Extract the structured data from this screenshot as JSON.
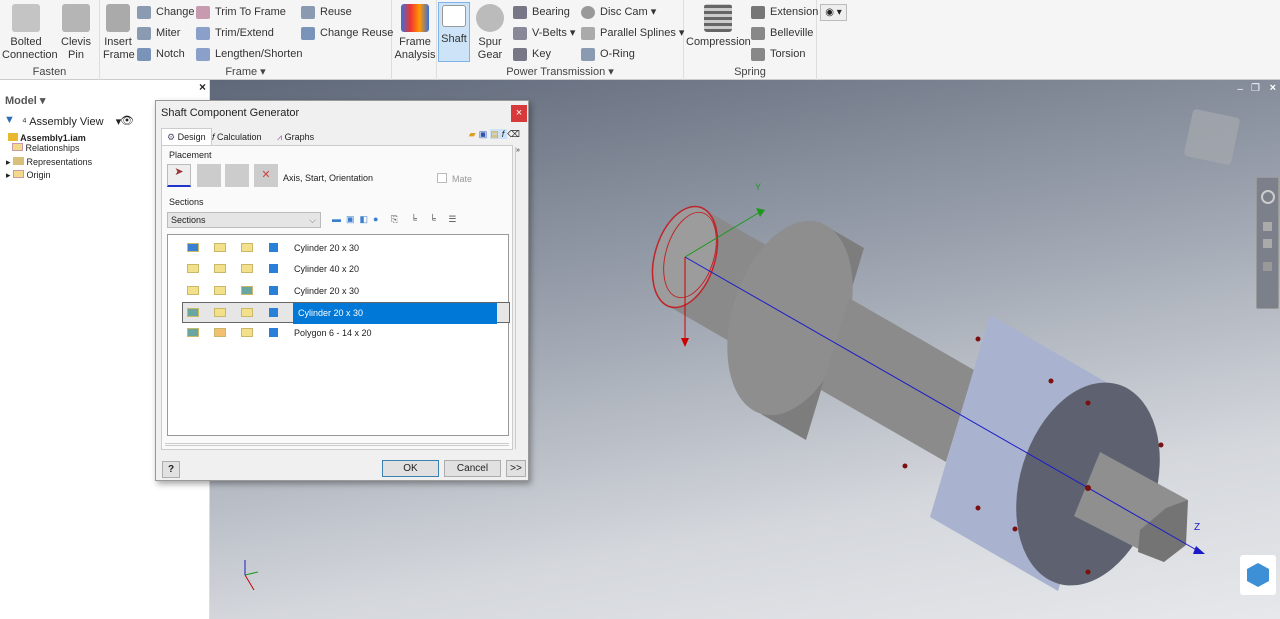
{
  "ribbon": {
    "fasten": {
      "label": "Fasten",
      "bolted": "Bolted\nConnection",
      "bolted1": "Bolted",
      "bolted2": "Connection",
      "clevis1": "Clevis",
      "clevis2": "Pin"
    },
    "frame": {
      "label": "Frame ▾",
      "insert1": "Insert",
      "insert2": "Frame",
      "change": "Change",
      "miter": "Miter",
      "notch": "Notch",
      "trim_to_frame": "Trim To Frame",
      "trim_extend": "Trim/Extend",
      "lengthen": "Lengthen/Shorten",
      "reuse": "Reuse",
      "change_reuse": "Change Reuse"
    },
    "analysis": {
      "l1": "Frame",
      "l2": "Analysis"
    },
    "power": {
      "label": "Power Transmission ▾",
      "shaft": "Shaft",
      "spur1": "Spur",
      "spur2": "Gear",
      "bearing": "Bearing",
      "vbelts": "V-Belts ▾",
      "key": "Key",
      "disc_cam": "Disc Cam ▾",
      "splines": "Parallel Splines ▾",
      "oring": "O-Ring"
    },
    "spring": {
      "label": "Spring",
      "compression": "Compression",
      "extension": "Extension",
      "belleville": "Belleville",
      "torsion": "Torsion"
    }
  },
  "browser": {
    "title": "Model ▾",
    "view": "Assembly View",
    "items": [
      "Assembly1.iam",
      "Relationships",
      "Representations",
      "Origin"
    ]
  },
  "dialog": {
    "title": "Shaft Component Generator",
    "close": "×",
    "tabs": [
      "Design",
      "Calculation",
      "Graphs"
    ],
    "placement_label": "Placement",
    "placement_text": "Axis, Start, Orientation",
    "mate": "Mate",
    "sections_label": "Sections",
    "sections_select": "Sections",
    "rows": [
      "Cylinder 20 x 30",
      "Cylinder 40 x 20",
      "Cylinder 20 x 30",
      "Cylinder 20 x 30",
      "Polygon 6 - 14 x 20"
    ],
    "selected_row": 3,
    "ok": "OK",
    "cancel": "Cancel",
    "more": ">>",
    "help": "?"
  },
  "viewport": {
    "axis_z": "Z",
    "axis_y": "Y",
    "accent": "#0078d7"
  }
}
